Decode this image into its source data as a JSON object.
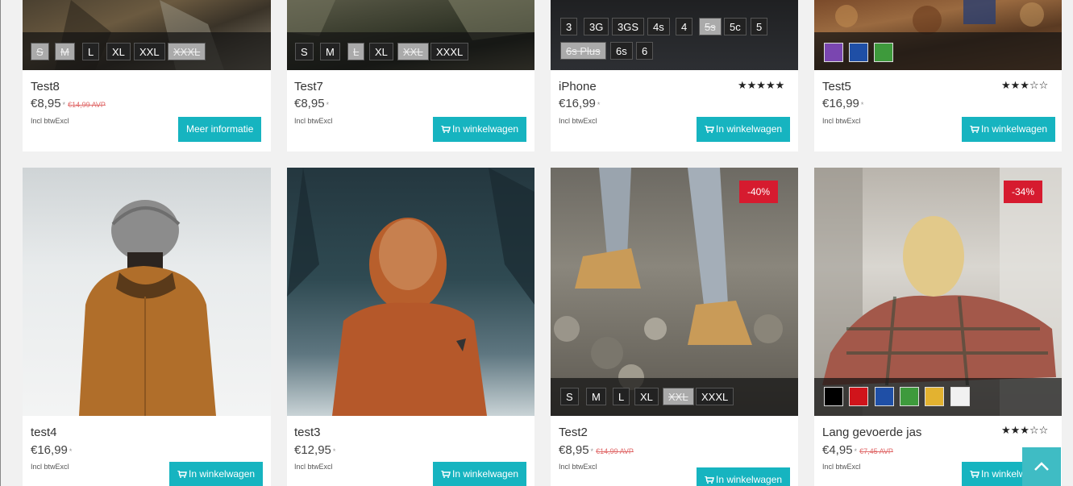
{
  "colors": {
    "accent": "#16b4c0",
    "discount_badge": "#d61b2f",
    "scroll_top": "#3fbcc4",
    "old_price": "#e06a6a"
  },
  "cart_icon": "shopping-cart-icon",
  "vat_note": "Incl btwExcl",
  "products_top": [
    {
      "name": "Test8",
      "price": "€8,95",
      "price_mark": "*",
      "old_price": "€14,99 AVP",
      "button": "Meer informatie",
      "options_row1": [
        "S",
        "M",
        "L",
        "XL",
        "XXL",
        "XXXL"
      ],
      "options_disabled": [
        "S",
        "M",
        "XXXL"
      ]
    },
    {
      "name": "Test7",
      "price": "€8,95",
      "price_mark": "*",
      "button": "In winkelwagen",
      "options_row1": [
        "S",
        "M",
        "L",
        "XL",
        "XXL",
        "XXXL"
      ],
      "options_disabled": [
        "L",
        "XXL"
      ]
    },
    {
      "name": "iPhone",
      "price": "€16,99",
      "price_mark": "*",
      "rating": 5,
      "stars_text": "★★★★★",
      "button": "In winkelwagen",
      "options_row1": [
        "3",
        "3G",
        "3GS",
        "4s",
        "4",
        "5s",
        "5c",
        "5"
      ],
      "options_row2": [
        "6s Plus",
        "6s",
        "6"
      ],
      "options_disabled": [
        "5s",
        "6s Plus"
      ]
    },
    {
      "name": "Test5",
      "price": "€16,99",
      "price_mark": "*",
      "rating": 3,
      "stars_text": "★★★☆☆",
      "button": "In winkelwagen",
      "swatch_colors": [
        "#7a46b0",
        "#1f4fa6",
        "#3e9a3c"
      ]
    }
  ],
  "products_bottom": [
    {
      "name": "test4",
      "price": "€16,99",
      "price_mark": "*",
      "button": "In winkelwagen"
    },
    {
      "name": "test3",
      "price": "€12,95",
      "price_mark": "*",
      "button": "In winkelwagen"
    },
    {
      "name": "Test2",
      "price": "€8,95",
      "price_mark": "*",
      "old_price": "€14,99 AVP",
      "badge": "-40%",
      "button": "In winkelwagen",
      "options_row1": [
        "S",
        "M",
        "L",
        "XL",
        "XXL",
        "XXXL"
      ],
      "options_disabled": [
        "XXL"
      ]
    },
    {
      "name": "Lang gevoerde jas",
      "price": "€4,95",
      "price_mark": "*",
      "old_price": "€7,45 AVP",
      "badge": "-34%",
      "rating": 3,
      "stars_text": "★★★☆☆",
      "button": "In winkelwagen",
      "swatch_colors": [
        "#000000",
        "#d0141b",
        "#1f4fa6",
        "#3e9a3c",
        "#e3b230",
        "#f1f1f1"
      ]
    }
  ]
}
